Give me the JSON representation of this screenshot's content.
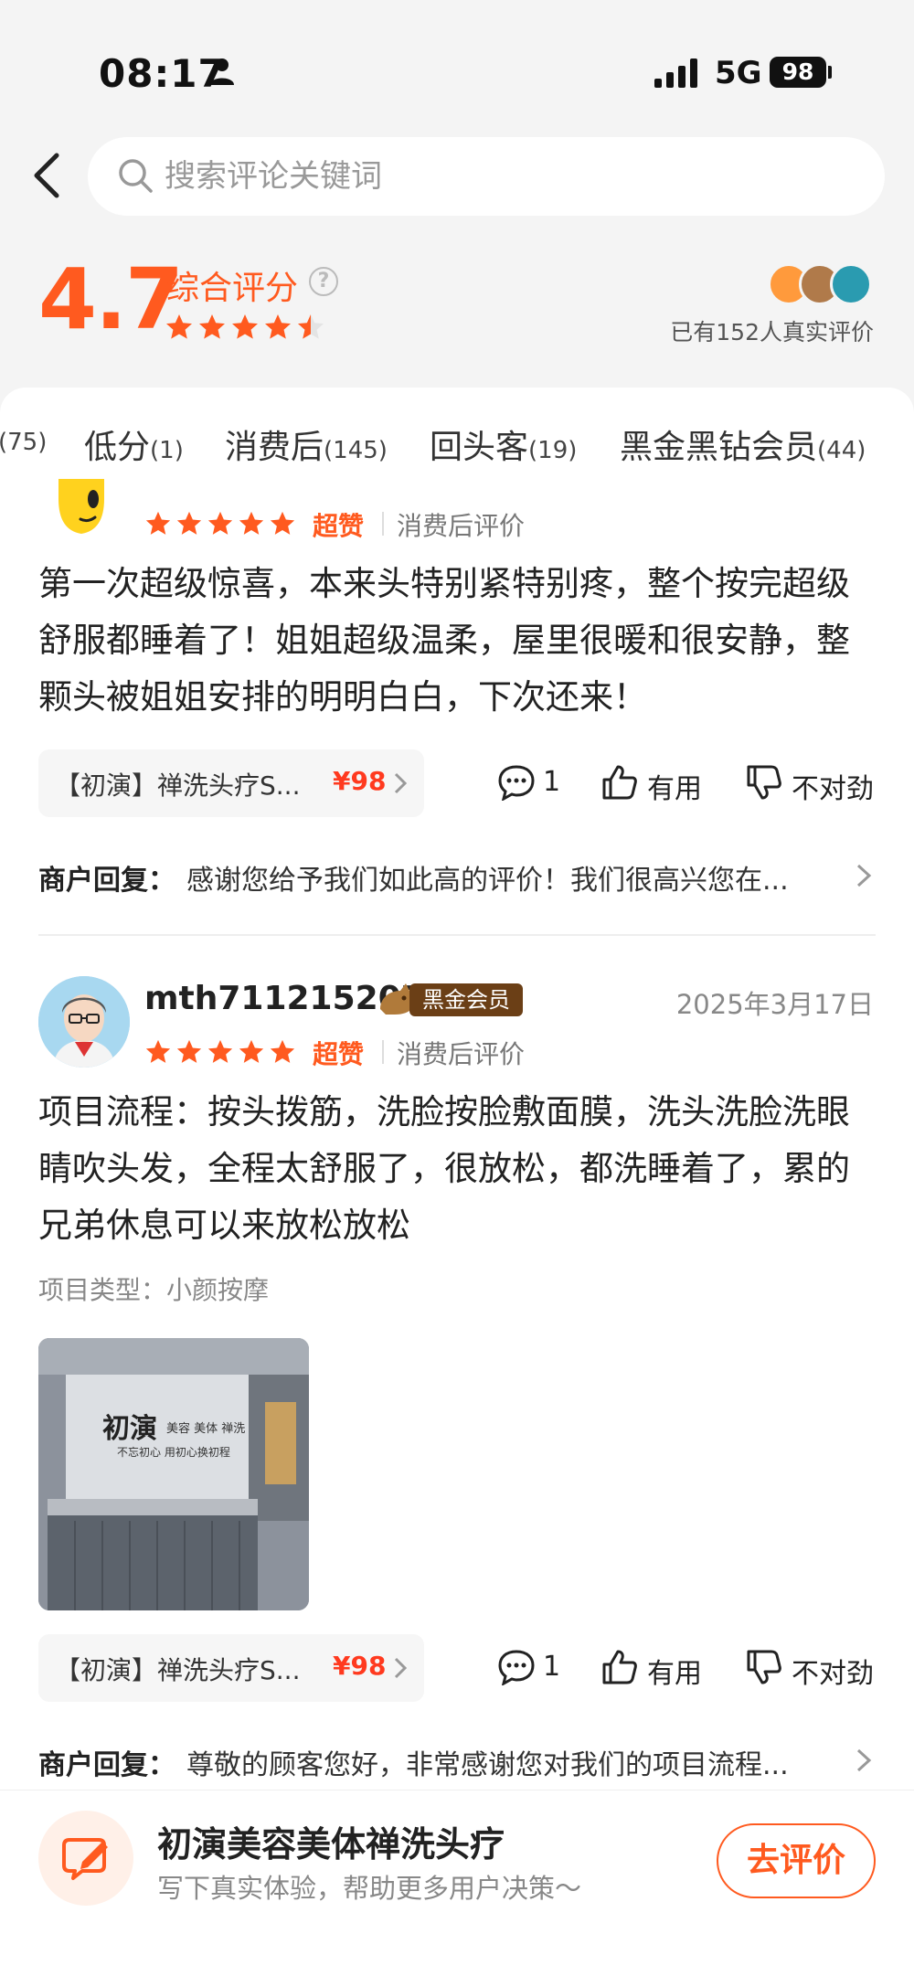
{
  "status_bar": {
    "time": "08:17",
    "network": "5G",
    "battery": "98"
  },
  "search": {
    "placeholder": "搜索评论关键词"
  },
  "rating": {
    "score": "4.7",
    "label": "综合评分",
    "help_symbol": "?",
    "stars": 4.5,
    "reviewer_count": "已有152人真实评价"
  },
  "tabs": [
    {
      "label": "",
      "count": "(75)"
    },
    {
      "label": "低分",
      "count": "(1)"
    },
    {
      "label": "消费后",
      "count": "(145)"
    },
    {
      "label": "回头客",
      "count": "(19)"
    },
    {
      "label": "黑金黑钻会员",
      "count": "(44)"
    }
  ],
  "reviews": [
    {
      "badge": "超赞",
      "type": "消费后评价",
      "text": "第一次超级惊喜，本来头特别紧特别疼，整个按完超级舒服都睡着了！姐姐超级温柔，屋里很暖和很安静，整颗头被姐姐安排的明明白白，下次还来！",
      "product": "【初演】禅洗头疗S...",
      "price": "¥98",
      "comments": "1",
      "useful": "有用",
      "not_right": "不对劲",
      "reply_label": "商户回复：",
      "reply_text": "感谢您给予我们如此高的评价！我们很高兴您在..."
    },
    {
      "username": "mth711215207",
      "member_badge": "黑金会员",
      "date": "2025年3月17日",
      "badge": "超赞",
      "type": "消费后评价",
      "text": "项目流程：按头拨筋，洗脸按脸敷面膜，洗头洗脸洗眼睛吹头发，全程太舒服了，很放松，都洗睡着了，累的兄弟休息可以来放松放松",
      "project_type": "项目类型：小颜按摩",
      "photo_sign_title": "初演",
      "photo_sign_sub": "美容 美体 禅洗",
      "photo_sign_motto": "不忘初心 用初心换初程",
      "product": "【初演】禅洗头疗S...",
      "price": "¥98",
      "comments": "1",
      "useful": "有用",
      "not_right": "不对劲",
      "reply_label": "商户回复：",
      "reply_text": "尊敬的顾客您好，非常感谢您对我们的项目流程..."
    }
  ],
  "bottom_bar": {
    "shop_name": "初演美容美体禅洗头疗",
    "subtitle": "写下真实体验，帮助更多用户决策～",
    "button": "去评价"
  },
  "colors": {
    "accent": "#ff5a1f",
    "price": "#ff3a1f",
    "member": "#6b3f16"
  }
}
